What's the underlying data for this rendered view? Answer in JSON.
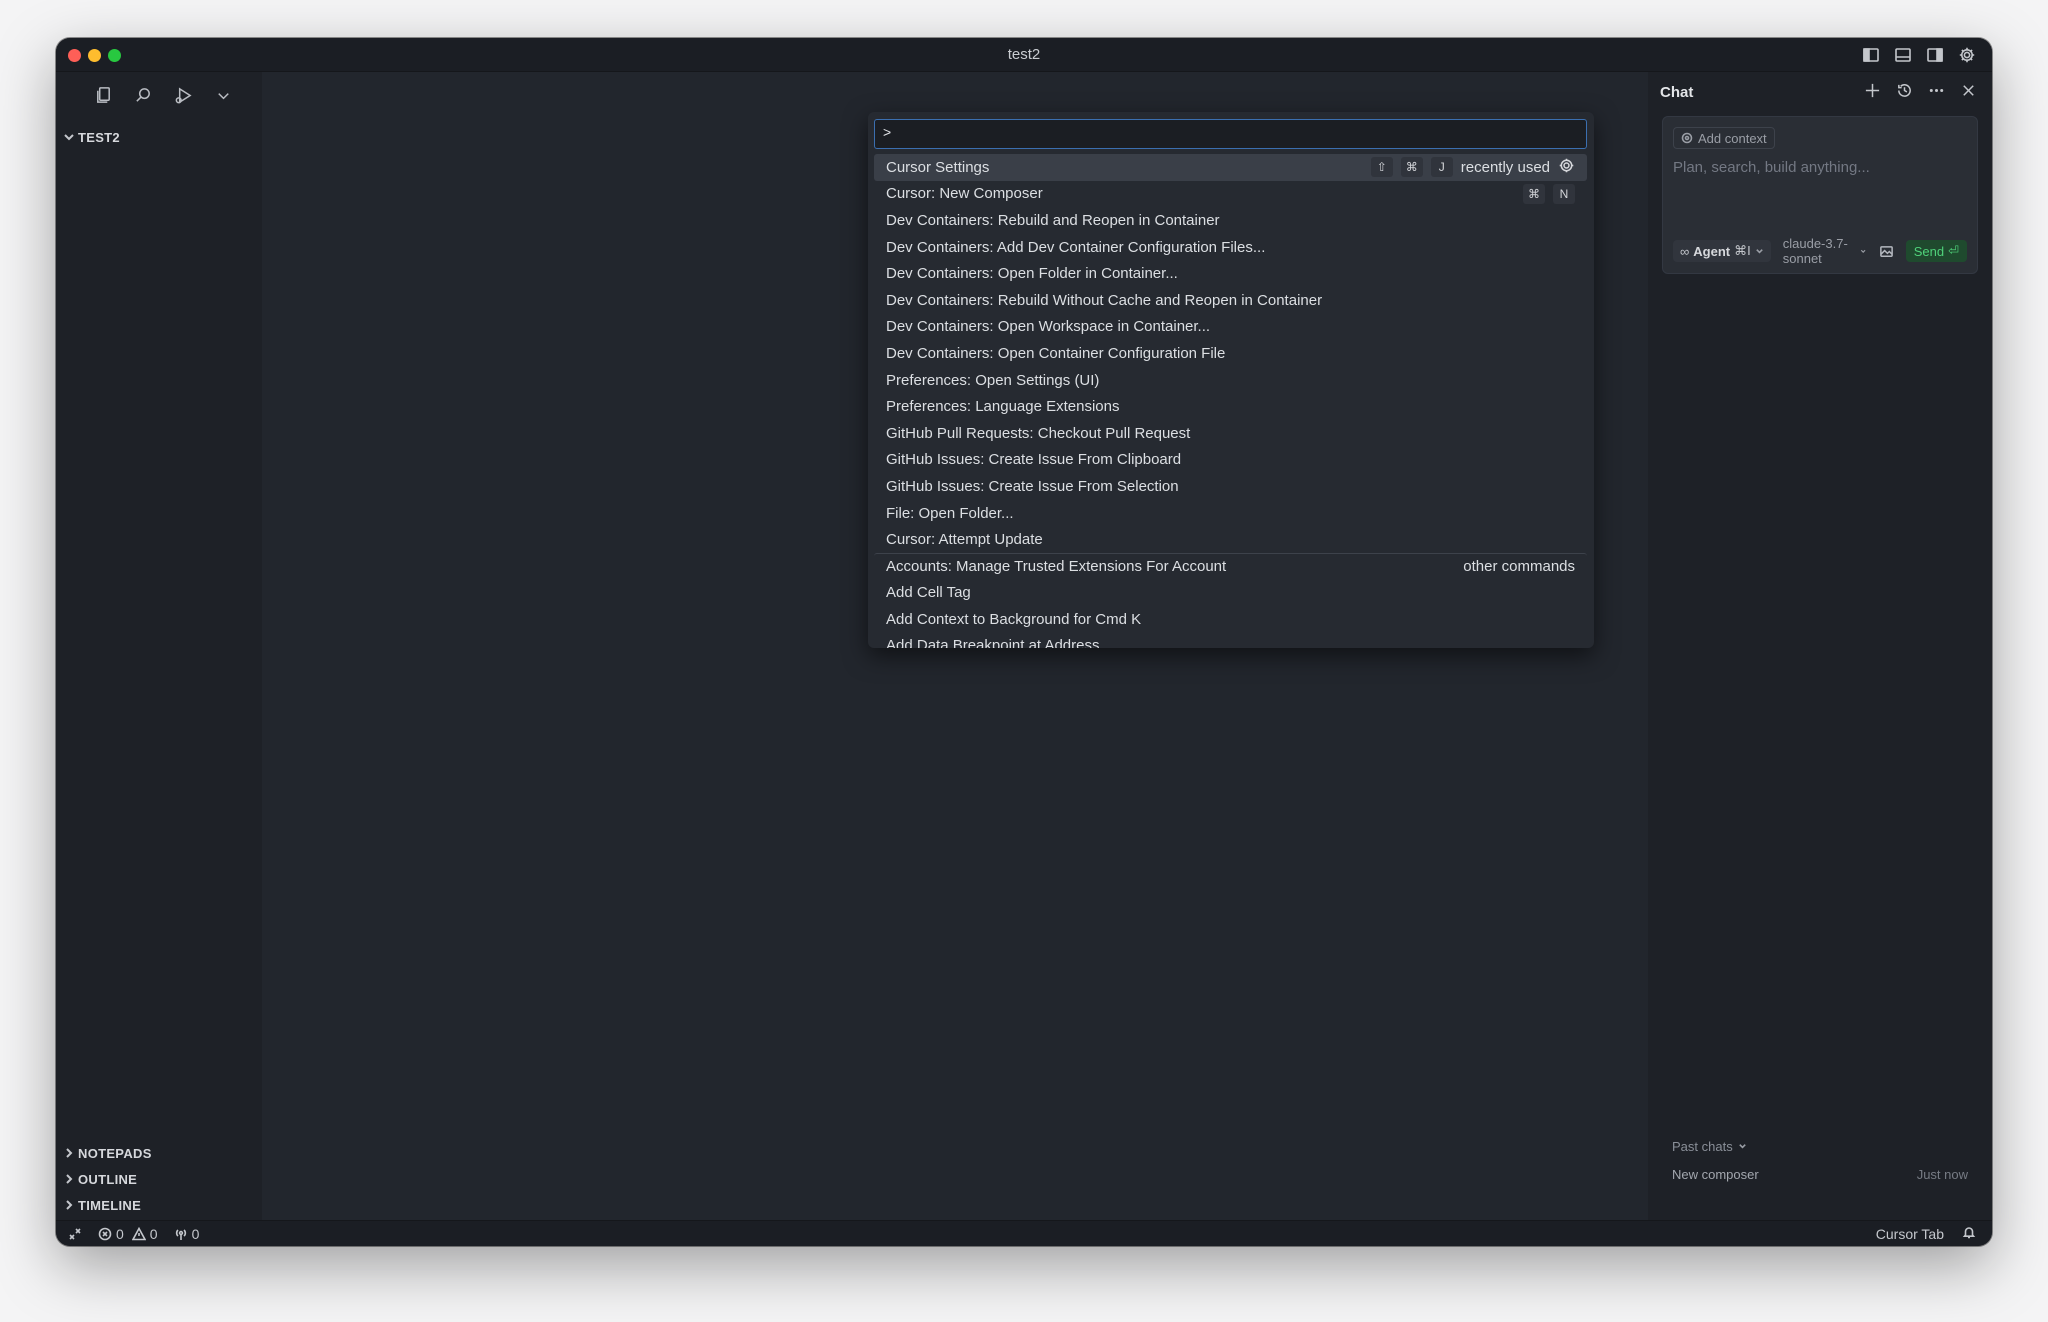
{
  "window": {
    "title": "test2"
  },
  "sidebar": {
    "toolbar_icons": [
      "files-icon",
      "search-icon",
      "run-debug-icon",
      "chevron-down-icon"
    ],
    "root_folder": "TEST2",
    "bottom_sections": [
      "NOTEPADS",
      "OUTLINE",
      "TIMELINE"
    ]
  },
  "command_palette": {
    "input_value": ">",
    "items": [
      {
        "label": "Cursor Settings",
        "keys": [
          "⇧",
          "⌘",
          "J"
        ],
        "tag": "recently used",
        "selected": true
      },
      {
        "label": "Cursor: New Composer",
        "keys": [
          "⌘",
          "N"
        ]
      },
      {
        "label": "Dev Containers: Rebuild and Reopen in Container"
      },
      {
        "label": "Dev Containers: Add Dev Container Configuration Files..."
      },
      {
        "label": "Dev Containers: Open Folder in Container..."
      },
      {
        "label": "Dev Containers: Rebuild Without Cache and Reopen in Container"
      },
      {
        "label": "Dev Containers: Open Workspace in Container..."
      },
      {
        "label": "Dev Containers: Open Container Configuration File"
      },
      {
        "label": "Preferences: Open Settings (UI)"
      },
      {
        "label": "Preferences: Language Extensions"
      },
      {
        "label": "GitHub Pull Requests: Checkout Pull Request"
      },
      {
        "label": "GitHub Issues: Create Issue From Clipboard"
      },
      {
        "label": "GitHub Issues: Create Issue From Selection"
      },
      {
        "label": "File: Open Folder..."
      },
      {
        "label": "Cursor: Attempt Update"
      },
      {
        "label": "Accounts: Manage Trusted Extensions For Account",
        "tag": "other commands",
        "separator": true
      },
      {
        "label": "Add Cell Tag"
      },
      {
        "label": "Add Context to Background for Cmd K"
      },
      {
        "label": "Add Data Breakpoint at Address"
      }
    ]
  },
  "chat": {
    "title": "Chat",
    "add_context": "Add context",
    "placeholder": "Plan, search, build anything...",
    "agent_label": "Agent",
    "agent_shortcut": "⌘I",
    "model": "claude-3.7-sonnet",
    "send_label": "Send",
    "send_key": "⏎",
    "past_chats_label": "Past chats",
    "past_chat": {
      "name": "New composer",
      "time": "Just now"
    }
  },
  "statusbar": {
    "errors": "0",
    "warnings": "0",
    "ports": "0",
    "cursor_tab": "Cursor Tab"
  }
}
